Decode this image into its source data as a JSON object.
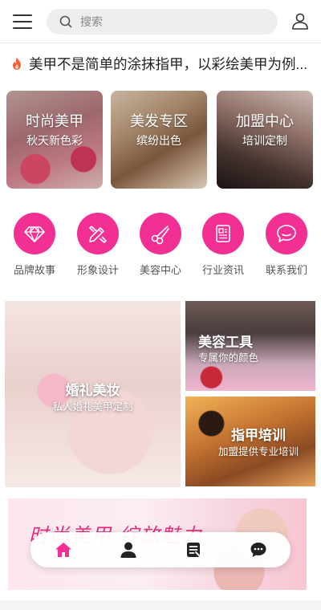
{
  "header": {
    "menu_icon": "hamburger-menu-icon",
    "search": {
      "placeholder": "搜索",
      "value": ""
    },
    "user_icon": "user-icon"
  },
  "notice": {
    "icon": "fire-icon",
    "icon_color": "#f0633a",
    "text": "美甲不是简单的涂抹指甲，以彩绘美甲为例..."
  },
  "banner_cards": [
    {
      "title": "时尚美甲",
      "subtitle": "秋天新色彩"
    },
    {
      "title": "美发专区",
      "subtitle": "缤纷出色"
    },
    {
      "title": "加盟中心",
      "subtitle": "培训定制"
    }
  ],
  "nav_icons": {
    "accent": "#f22f93",
    "items": [
      {
        "label": "品牌故事",
        "icon": "diamond-icon"
      },
      {
        "label": "形象设计",
        "icon": "pencil-ruler-icon"
      },
      {
        "label": "美容中心",
        "icon": "scissors-icon"
      },
      {
        "label": "行业资讯",
        "icon": "news-icon"
      },
      {
        "label": "联系我们",
        "icon": "chat-icon"
      }
    ]
  },
  "features": {
    "wedding": {
      "title": "婚礼美妆",
      "subtitle": "私人婚礼美甲定制"
    },
    "tools": {
      "title": "美容工具",
      "subtitle": "专属你的颜色"
    },
    "training": {
      "title": "指甲培训",
      "subtitle": "加盟提供专业培训"
    }
  },
  "promo": {
    "title": "时尚美甲 绽放魅力"
  },
  "tabbar": {
    "active_color": "#f22f93",
    "items": [
      {
        "icon": "home-icon",
        "active": true
      },
      {
        "icon": "person-icon",
        "active": false
      },
      {
        "icon": "document-icon",
        "active": false
      },
      {
        "icon": "message-icon",
        "active": false
      }
    ]
  }
}
